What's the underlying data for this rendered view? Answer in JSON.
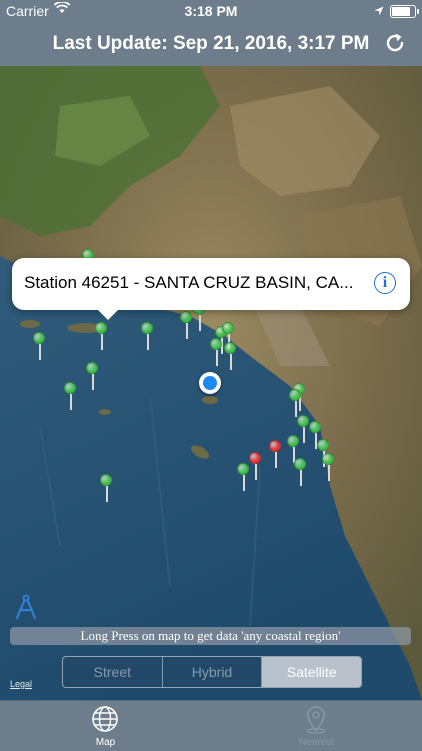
{
  "status_bar": {
    "carrier": "Carrier",
    "time": "3:18 PM",
    "battery_level": 0.9
  },
  "header": {
    "title": "Last Update: Sep 21, 2016, 3:17 PM",
    "refresh_icon": "refresh-icon"
  },
  "map": {
    "type": "satellite",
    "callout": {
      "label": "Station 46251 - SANTA CRUZ BASIN, CA...",
      "info_icon": "info-icon",
      "info_glyph": "i"
    },
    "pin_colors": {
      "normal": "#3fc14a",
      "alert": "#e73535"
    },
    "hint": "Long Press on map to get data 'any coastal region'",
    "map_types": [
      "Street",
      "Hybrid",
      "Satellite"
    ],
    "selected_map_type": "Satellite",
    "legal": "Legal"
  },
  "tabbar": {
    "items": [
      {
        "label": "Map",
        "icon": "globe-icon",
        "selected": true
      },
      {
        "label": "Nearest",
        "icon": "location-pin-icon",
        "selected": false
      }
    ]
  }
}
